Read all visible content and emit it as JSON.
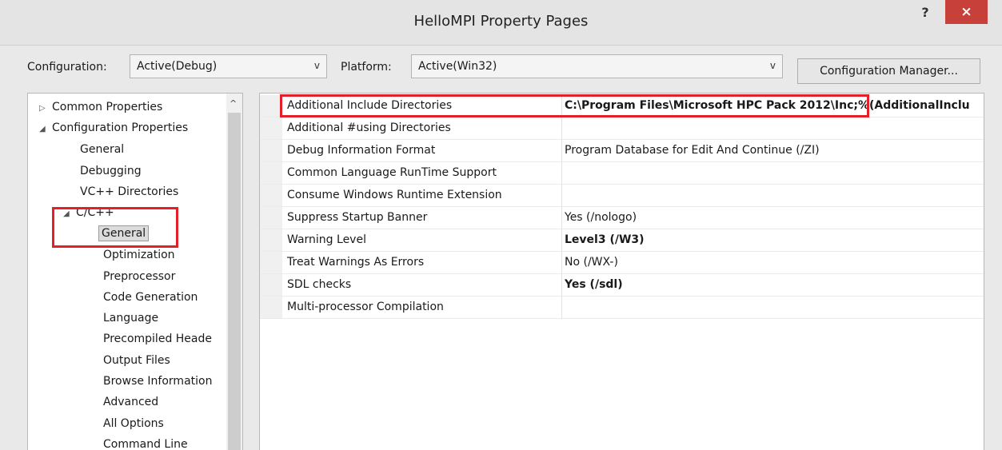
{
  "window": {
    "title": "HelloMPI Property Pages",
    "help": "?",
    "close": "×"
  },
  "config": {
    "configuration_label": "Configuration:",
    "configuration_value": "Active(Debug)",
    "platform_label": "Platform:",
    "platform_value": "Active(Win32)",
    "manager_button": "Configuration Manager...",
    "dropdown_glyph": "v"
  },
  "tree": {
    "nodes": [
      {
        "label": "Common Properties",
        "twisty": "▷"
      },
      {
        "label": "Configuration Properties",
        "twisty": "◢"
      },
      {
        "label": "General",
        "twisty": ""
      },
      {
        "label": "Debugging",
        "twisty": ""
      },
      {
        "label": "VC++ Directories",
        "twisty": ""
      },
      {
        "label": "C/C++",
        "twisty": "◢"
      },
      {
        "label": "General",
        "twisty": ""
      },
      {
        "label": "Optimization",
        "twisty": ""
      },
      {
        "label": "Preprocessor",
        "twisty": ""
      },
      {
        "label": "Code Generation",
        "twisty": ""
      },
      {
        "label": "Language",
        "twisty": ""
      },
      {
        "label": "Precompiled Heade",
        "twisty": ""
      },
      {
        "label": "Output Files",
        "twisty": ""
      },
      {
        "label": "Browse Information",
        "twisty": ""
      },
      {
        "label": "Advanced",
        "twisty": ""
      },
      {
        "label": "All Options",
        "twisty": ""
      },
      {
        "label": "Command Line",
        "twisty": ""
      }
    ],
    "selected": "General",
    "scroll_up": "^"
  },
  "properties": [
    {
      "name": "Additional Include Directories",
      "value": "C:\\Program Files\\Microsoft HPC Pack 2012\\Inc;%(AdditionalInclu",
      "bold": true
    },
    {
      "name": "Additional #using Directories",
      "value": "",
      "bold": false
    },
    {
      "name": "Debug Information Format",
      "value": "Program Database for Edit And Continue (/ZI)",
      "bold": false
    },
    {
      "name": "Common Language RunTime Support",
      "value": "",
      "bold": false
    },
    {
      "name": "Consume Windows Runtime Extension",
      "value": "",
      "bold": false
    },
    {
      "name": "Suppress Startup Banner",
      "value": "Yes (/nologo)",
      "bold": false
    },
    {
      "name": "Warning Level",
      "value": "Level3 (/W3)",
      "bold": true
    },
    {
      "name": "Treat Warnings As Errors",
      "value": "No (/WX-)",
      "bold": false
    },
    {
      "name": "SDL checks",
      "value": "Yes (/sdl)",
      "bold": true
    },
    {
      "name": "Multi-processor Compilation",
      "value": "",
      "bold": false
    }
  ],
  "colors": {
    "highlight_box": "#e3202a",
    "close_button": "#c7413a"
  }
}
